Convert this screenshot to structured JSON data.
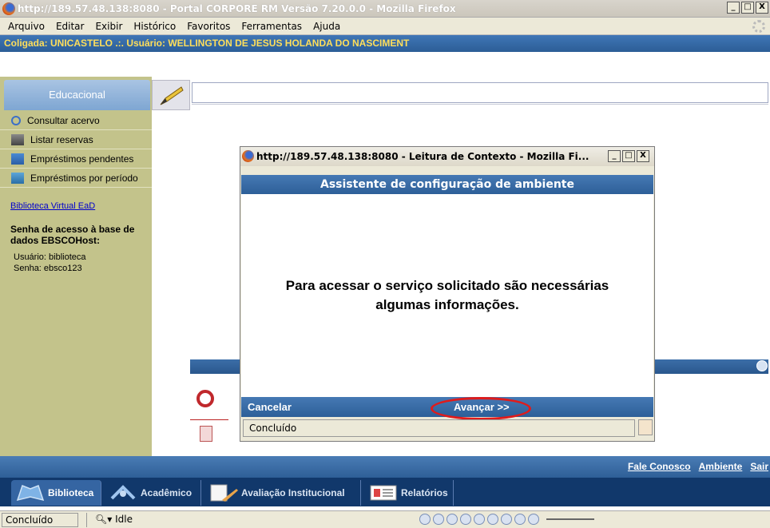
{
  "window": {
    "title": "http://189.57.48.138:8080 - Portal CORPORE RM Versão 7.20.0.0 - Mozilla Firefox",
    "min": "_",
    "max": "□",
    "close": "X"
  },
  "menubar": [
    "Arquivo",
    "Editar",
    "Exibir",
    "Histórico",
    "Favoritos",
    "Ferramentas",
    "Ajuda"
  ],
  "coligada": "Coligada: UNICASTELO .:. Usuário: WELLINGTON DE JESUS HOLANDA DO NASCIMENT",
  "sidebar": {
    "tab_label": "Educacional",
    "items": [
      {
        "label": "Consultar acervo",
        "icon": "search-icon"
      },
      {
        "label": "Listar reservas",
        "icon": "list-icon"
      },
      {
        "label": "Empréstimos pendentes",
        "icon": "pending-icon"
      },
      {
        "label": "Empréstimos por período",
        "icon": "calendar-icon"
      }
    ],
    "link": "Biblioteca Virtual EaD",
    "senha_title": "Senha de acesso à base de dados EBSCOHost:",
    "usuario": "Usuário: biblioteca",
    "senha": "Senha: ebsco123"
  },
  "popup": {
    "title": "http://189.57.48.138:8080 - Leitura de Contexto - Mozilla Fi...",
    "header": "Assistente de configuração de ambiente",
    "message_line1": "Para acessar o serviço solicitado são necessárias",
    "message_line2": "algumas informações.",
    "cancel": "Cancelar",
    "next": "Avançar >>",
    "status": "Concluído"
  },
  "footer_links": [
    "Fale Conosco",
    "Ambiente",
    "Sair"
  ],
  "tabs": [
    {
      "label": "Biblioteca",
      "icon": "books-icon",
      "active": true
    },
    {
      "label": "Acadêmico",
      "icon": "academic-icon",
      "active": false
    },
    {
      "label": "Avaliação Institucional",
      "icon": "evaluation-icon",
      "active": false
    },
    {
      "label": "Relatórios",
      "icon": "report-icon",
      "active": false
    }
  ],
  "statusbar": {
    "done": "Concluído",
    "idle": "Idle"
  },
  "colors": {
    "accent_blue": "#2d5f98",
    "sidebar": "#c3c38b",
    "highlight_red": "#e01b1b",
    "coligada_text": "#ffde5a"
  }
}
